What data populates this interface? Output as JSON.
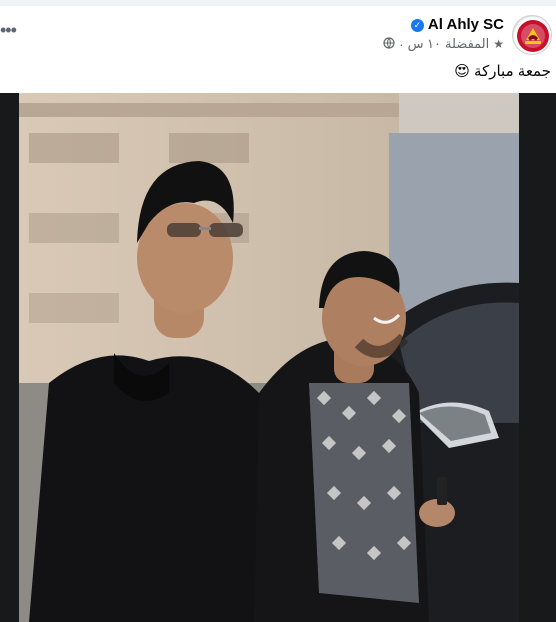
{
  "post": {
    "page_name": "Al Ahly SC",
    "verified_badge": "✓",
    "time": "١٠ س",
    "separator": "·",
    "audience": "المفضلة",
    "caption": "جمعة مباركة",
    "caption_emoji": "😍",
    "more_options": "•••"
  },
  "photo": {
    "description_icon": "photo-icon"
  },
  "colors": {
    "brand": "#c8102e",
    "verified": "#1877f2",
    "meta_text": "#65676b"
  }
}
